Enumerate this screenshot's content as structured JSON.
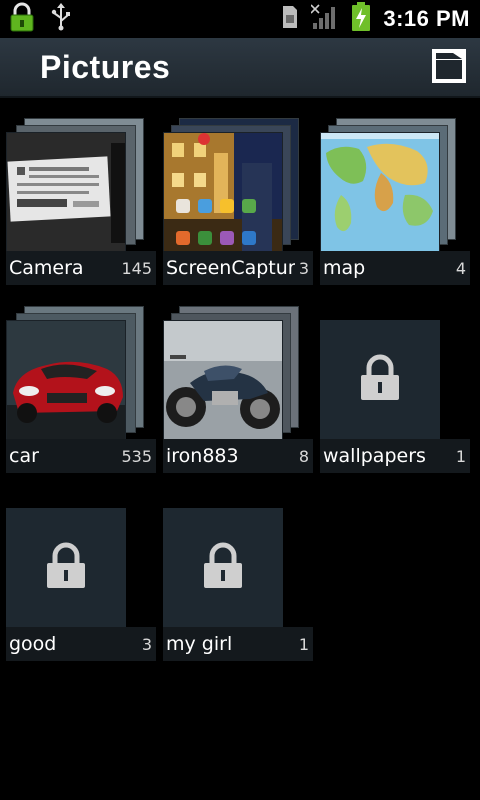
{
  "status_bar": {
    "time": "3:16 PM",
    "icons": [
      "lock-icon",
      "usb-icon",
      "sim-card-icon",
      "signal-icon",
      "battery-charging-icon"
    ]
  },
  "action_bar": {
    "title": "Pictures",
    "camera_icon": "camera-icon"
  },
  "albums": [
    {
      "name": "Camera",
      "count": "145",
      "thumbnail": "photo-label-card",
      "locked": false
    },
    {
      "name": "ScreenCaptur",
      "count": "3",
      "thumbnail": "photo-street-night",
      "locked": false
    },
    {
      "name": "map",
      "count": "4",
      "thumbnail": "photo-world-map",
      "locked": false
    },
    {
      "name": "car",
      "count": "535",
      "thumbnail": "photo-red-car",
      "locked": false
    },
    {
      "name": "iron883",
      "count": "8",
      "thumbnail": "photo-motorcycle",
      "locked": false
    },
    {
      "name": "wallpapers",
      "count": "1",
      "thumbnail": "lock-icon",
      "locked": true
    },
    {
      "name": "good",
      "count": "3",
      "thumbnail": "lock-icon",
      "locked": true
    },
    {
      "name": "my girl",
      "count": "1",
      "thumbnail": "lock-icon",
      "locked": true
    }
  ],
  "colors": {
    "action_bar": "#2a343d",
    "label_bg": "#14191d",
    "locked_bg": "#1e2830",
    "battery": "#6fbf2a",
    "lock_green": "#5fb51f"
  }
}
